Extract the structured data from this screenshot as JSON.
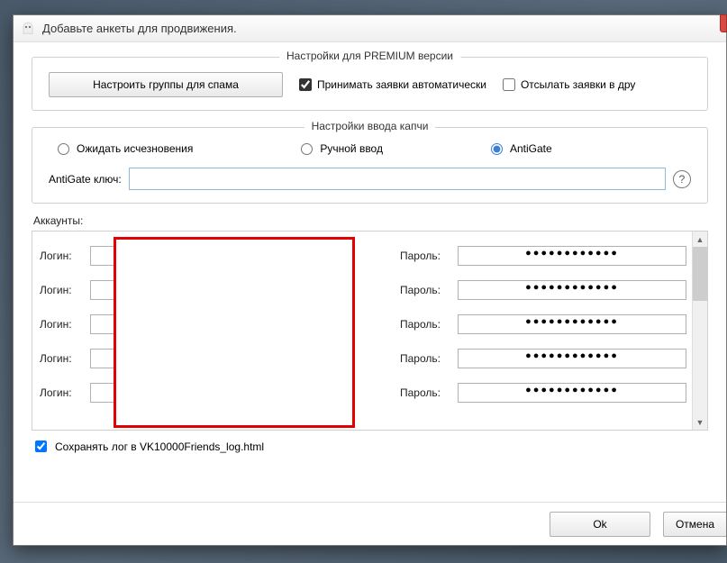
{
  "window": {
    "title": "Добавьте анкеты для продвижения."
  },
  "premium": {
    "legend": "Настройки для PREMIUM версии",
    "spam_groups_button": "Настроить группы для спама",
    "accept_auto_label": "Принимать заявки автоматически",
    "accept_auto_checked": true,
    "send_requests_label": "Отсылать заявки в дру",
    "send_requests_checked": false
  },
  "captcha": {
    "legend": "Настройки ввода капчи",
    "radios": {
      "wait": "Ожидать исчезновения",
      "manual": "Ручной ввод",
      "antigate": "AntiGate"
    },
    "selected": "antigate",
    "key_label": "AntiGate ключ:",
    "key_value": "",
    "help_tooltip": "?"
  },
  "accounts": {
    "label": "Аккаунты:",
    "login_label": "Логин:",
    "password_label": "Пароль:",
    "rows": [
      {
        "login": "",
        "password": "●●●●●●●●●●●●"
      },
      {
        "login": "",
        "password": "●●●●●●●●●●●●"
      },
      {
        "login": "",
        "password": "●●●●●●●●●●●●"
      },
      {
        "login": "",
        "password": "●●●●●●●●●●●●"
      },
      {
        "login": "",
        "password": "●●●●●●●●●●●●"
      }
    ]
  },
  "log": {
    "checked": true,
    "label": "Сохранять лог в VK10000Friends_log.html"
  },
  "footer": {
    "ok": "Ok",
    "cancel": "Отмена"
  }
}
